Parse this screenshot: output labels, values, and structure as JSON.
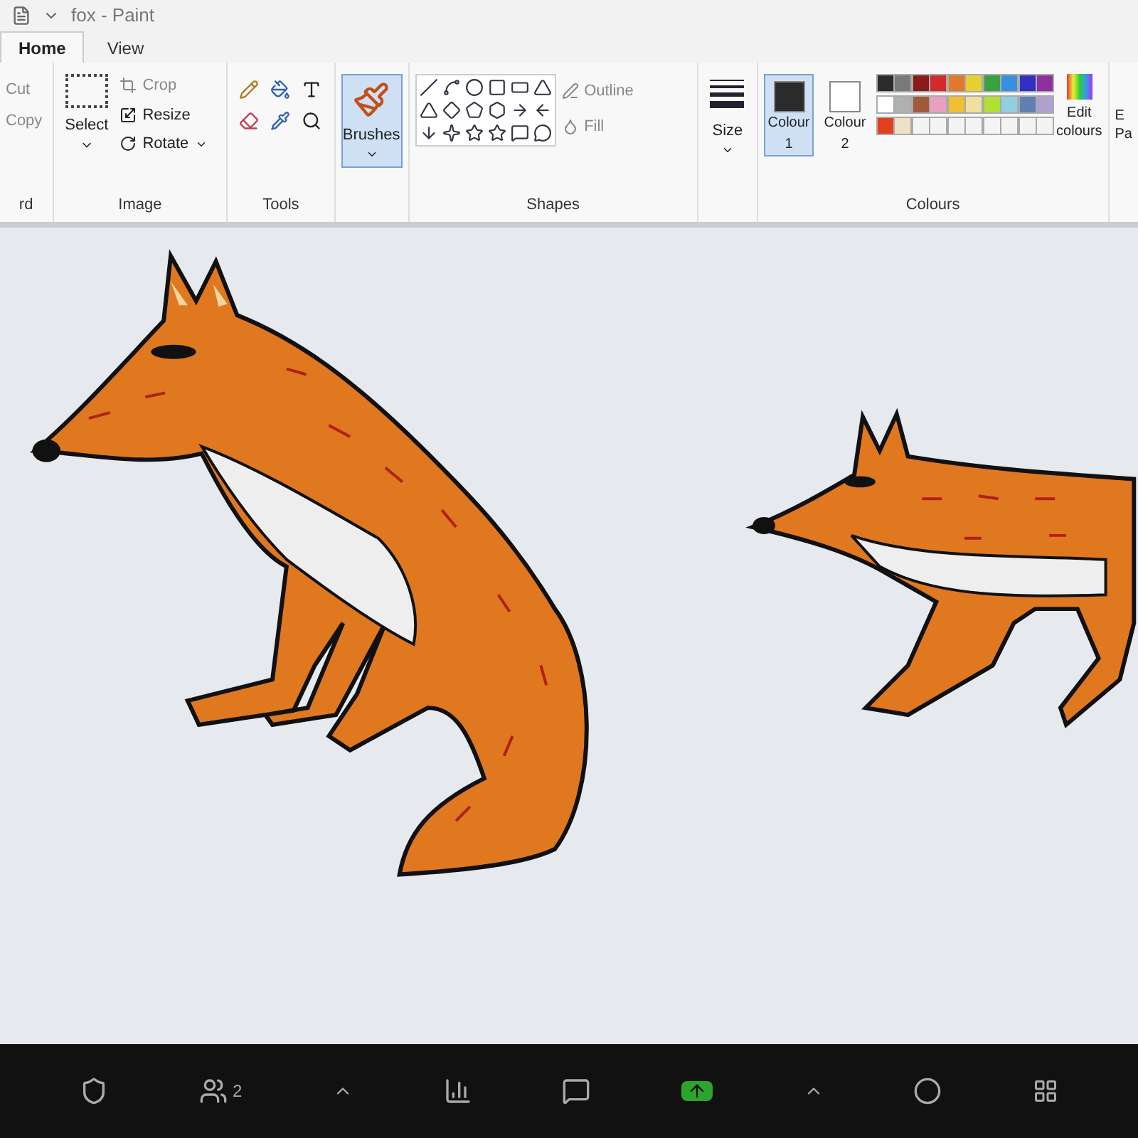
{
  "window": {
    "title": "fox - Paint"
  },
  "tabs": [
    {
      "label": "Home",
      "selected": true
    },
    {
      "label": "View",
      "selected": false
    }
  ],
  "clipboard": {
    "items": [
      "Cut",
      "Copy"
    ],
    "label": "rd"
  },
  "image_group": {
    "select": "Select",
    "crop": "Crop",
    "resize": "Resize",
    "rotate": "Rotate",
    "label": "Image"
  },
  "tools_group": {
    "label": "Tools"
  },
  "brushes": {
    "label": "Brushes",
    "selected": true
  },
  "shapes_group": {
    "outline": "Outline",
    "fill": "Fill",
    "label": "Shapes"
  },
  "size": {
    "label": "Size"
  },
  "colours_group": {
    "colour_1": {
      "label": "Colour",
      "number": "1",
      "color": "#2b2b2b",
      "selected": true
    },
    "colour_2": {
      "label": "Colour",
      "number": "2",
      "color": "#ffffff",
      "selected": false
    },
    "palette": [
      {
        "color": "#2b2b2b"
      },
      {
        "color": "#7a7a7a"
      },
      {
        "color": "#8b1a1a"
      },
      {
        "color": "#d42a2a"
      },
      {
        "color": "#e07a2a"
      },
      {
        "color": "#e8d030"
      },
      {
        "color": "#3aa040"
      },
      {
        "color": "#3a90e0"
      },
      {
        "color": "#3030c0"
      },
      {
        "color": "#9030a0"
      },
      {
        "color": "#ffffff"
      },
      {
        "color": "#b0b0b0"
      },
      {
        "color": "#a05a3a"
      },
      {
        "color": "#e8a0c0"
      },
      {
        "color": "#f0c030"
      },
      {
        "color": "#f0e0a0"
      },
      {
        "color": "#b0e030"
      },
      {
        "color": "#90d0e0"
      },
      {
        "color": "#6080b0"
      },
      {
        "color": "#b0a0d0"
      },
      {
        "color": "#e04020"
      },
      {
        "color": "#f0e0c8"
      },
      {
        "color": "#f4f4f4"
      },
      {
        "color": "#f4f4f4"
      },
      {
        "color": "#f4f4f4"
      },
      {
        "color": "#f4f4f4"
      },
      {
        "color": "#f4f4f4"
      },
      {
        "color": "#f4f4f4"
      },
      {
        "color": "#f4f4f4"
      },
      {
        "color": "#f4f4f4"
      }
    ],
    "edit_colours": "Edit colours",
    "label": "Colours"
  },
  "cut_off_group": {
    "line_1": "E",
    "line_2": "Pa"
  },
  "meeting_bar": {
    "participants": "2"
  }
}
